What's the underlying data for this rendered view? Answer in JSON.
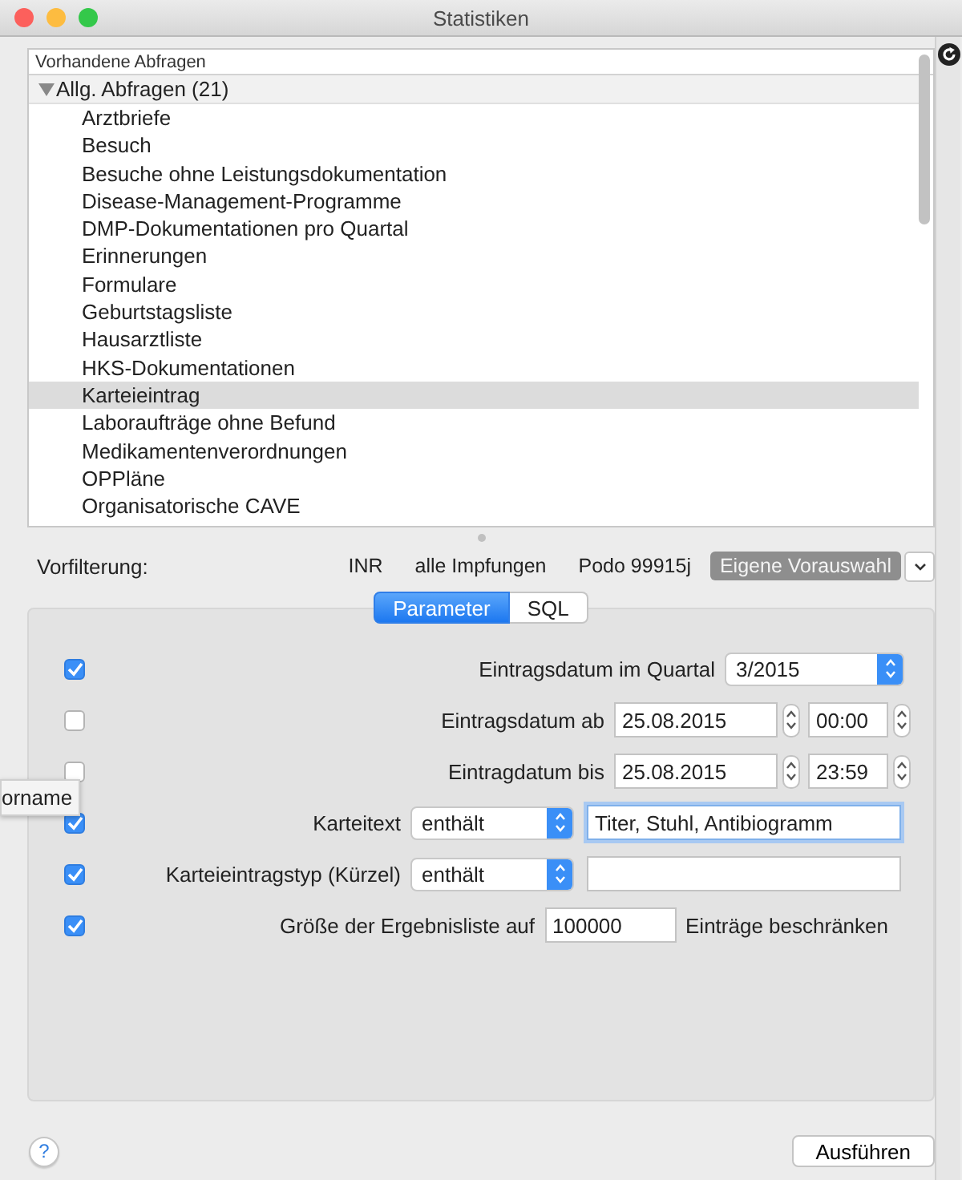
{
  "window": {
    "title": "Statistiken"
  },
  "query_list": {
    "header": "Vorhandene Abfragen",
    "groups": [
      {
        "label": "Allg. Abfragen (21)",
        "expanded": true,
        "children": [
          {
            "label": "Arztbriefe",
            "selected": false
          },
          {
            "label": "Besuch",
            "selected": false
          },
          {
            "label": "Besuche ohne Leistungsdokumentation",
            "selected": false
          },
          {
            "label": "Disease-Management-Programme",
            "selected": false
          },
          {
            "label": "DMP-Dokumentationen pro Quartal",
            "selected": false
          },
          {
            "label": "Erinnerungen",
            "selected": false
          },
          {
            "label": "Formulare",
            "selected": false
          },
          {
            "label": "Geburtstagsliste",
            "selected": false
          },
          {
            "label": "Hausarztliste",
            "selected": false
          },
          {
            "label": "HKS-Dokumentationen",
            "selected": false
          },
          {
            "label": "Karteieintrag",
            "selected": true
          },
          {
            "label": "Laboraufträge ohne Befund",
            "selected": false
          },
          {
            "label": "Medikamentenverordnungen",
            "selected": false
          },
          {
            "label": "OPPläne",
            "selected": false
          },
          {
            "label": "Organisatorische CAVE",
            "selected": false
          }
        ]
      }
    ]
  },
  "prefilter": {
    "label": "Vorfilterung:",
    "presets": [
      {
        "label": "INR",
        "selected": false
      },
      {
        "label": "alle Impfungen",
        "selected": false
      },
      {
        "label": "Podo 99915j",
        "selected": false
      },
      {
        "label": "Eigene Vorauswahl",
        "selected": true
      }
    ]
  },
  "tabs": [
    {
      "label": "Parameter",
      "selected": true
    },
    {
      "label": "SQL",
      "selected": false
    }
  ],
  "parameters": [
    {
      "kind": "quarter",
      "checked": true,
      "label": "Eintragsdatum im Quartal",
      "value": "3/2015"
    },
    {
      "kind": "datetime",
      "checked": false,
      "label": "Eintragsdatum ab",
      "date": "25.08.2015",
      "time": "00:00"
    },
    {
      "kind": "datetime",
      "checked": false,
      "label": "Eintragdatum bis",
      "date": "25.08.2015",
      "time": "23:59"
    },
    {
      "kind": "text-match",
      "checked": true,
      "label": "Karteitext",
      "operator": "enthält",
      "value": "Titer, Stuhl, Antibiogramm",
      "focused": true
    },
    {
      "kind": "text-match",
      "checked": true,
      "label": "Karteieintragstyp (Kürzel)",
      "operator": "enthält",
      "focused": false
    },
    {
      "kind": "limit",
      "checked": true,
      "label": "Größe der Ergebnisliste auf",
      "value": "100000",
      "suffix": "Einträge beschränken"
    }
  ],
  "tooltip": {
    "text": "orname"
  },
  "help_button": "?",
  "run_button": "Ausführen"
}
